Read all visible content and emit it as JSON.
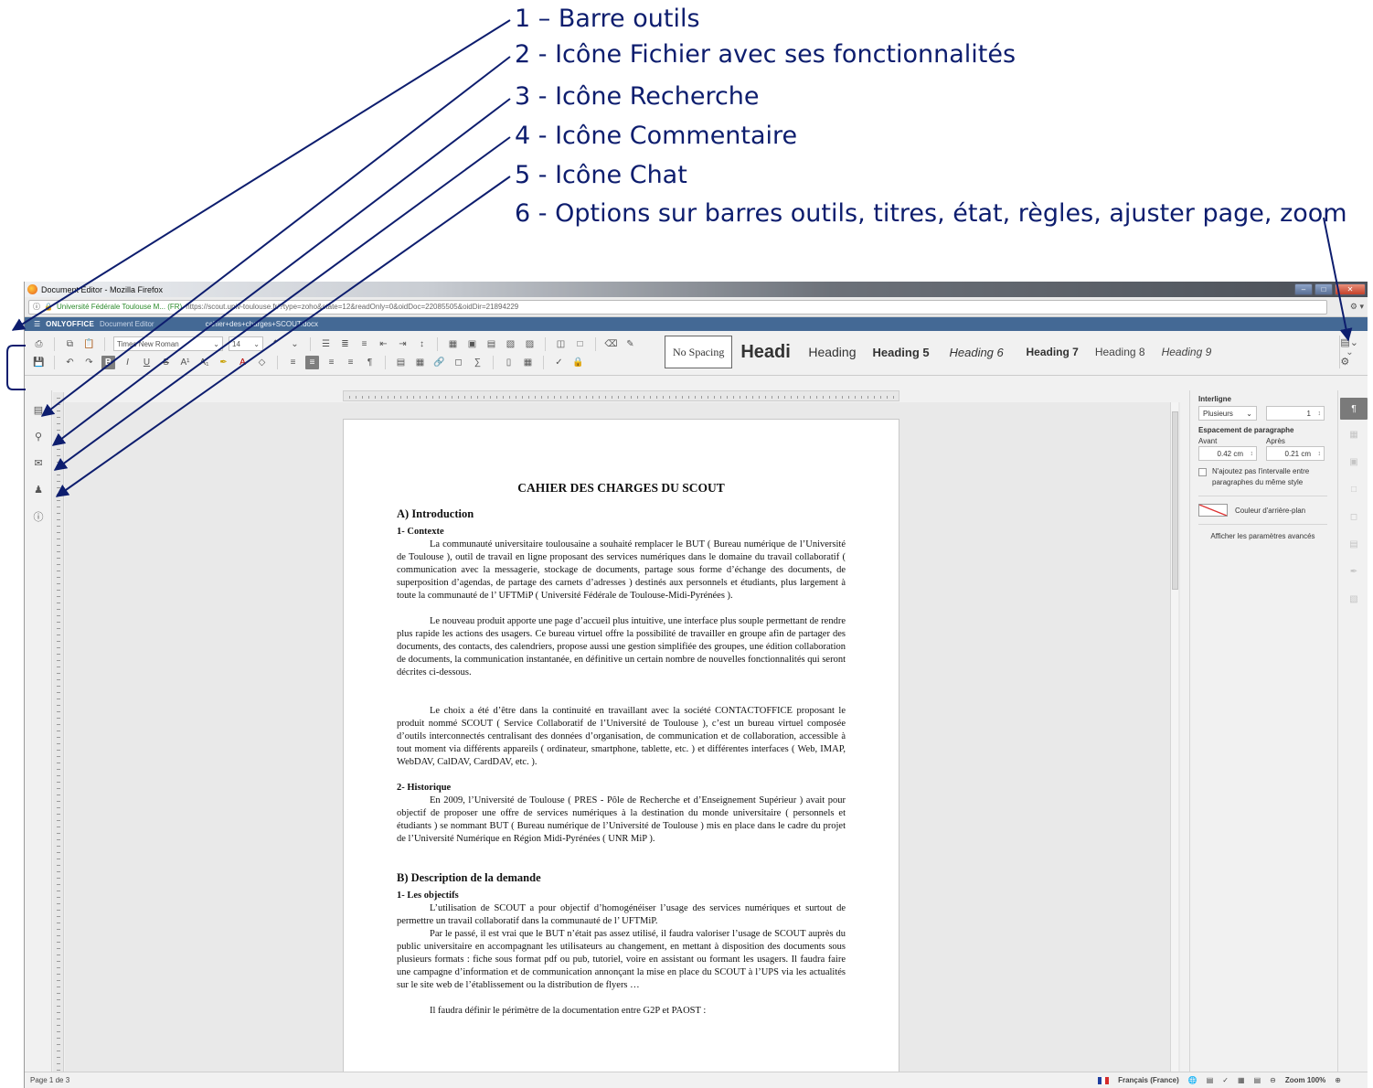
{
  "annotations": [
    "1 – Barre outils",
    "2 - Icône Fichier avec ses fonctionnalités",
    "3 - Icône Recherche",
    "4 - Icône Commentaire",
    "5 - Icône Chat",
    "6 - Options sur barres outils, titres, état, règles, ajuster page, zoom"
  ],
  "browser": {
    "title": "Document Editor - Mozilla Firefox",
    "site_identity": "Université Fédérale Toulouse M... (FR)",
    "url": "https://scout.univ-toulouse.fr/?type=zoho&state=12&readOnly=0&oidDoc=22085505&oidDir=21894229"
  },
  "app": {
    "brand": "ONLYOFFICE",
    "subtitle": "Document Editor",
    "doc_name": "cahier+des+charges+SCOUT.docx"
  },
  "toolbar": {
    "font_name": "Times New Roman",
    "font_size": "14",
    "styles": [
      "No Spacing",
      "Headi",
      "Heading",
      "Heading 5",
      "Heading 6",
      "Heading 7",
      "Heading 8",
      "Heading 9"
    ]
  },
  "document": {
    "title": "CAHIER DES CHARGES DU SCOUT",
    "section_a": "A) Introduction",
    "sub_1": "1- Contexte",
    "p1": "La communauté universitaire toulousaine a souhaité remplacer le BUT ( Bureau numérique de l’Université de Toulouse ), outil de travail en ligne proposant des services numériques dans le domaine du travail collaboratif ( communication avec la messagerie, stockage de documents, partage sous forme d’échange des documents, de superposition d’agendas, de partage des carnets d’adresses ) destinés aux personnels et étudiants, plus largement à toute la communauté de l’ UFTMiP ( Université Fédérale de Toulouse-Midi-Pyrénées ).",
    "p2": "Le nouveau produit apporte une page d’accueil plus intuitive, une interface plus souple permettant de rendre plus rapide les actions des usagers. Ce bureau virtuel offre la possibilité de travailler en groupe afin de partager des documents, des contacts, des calendriers, propose aussi une gestion simplifiée des groupes, une édition collaboration de documents, la communication instantanée, en définitive un certain nombre de nouvelles fonctionnalités qui seront décrites ci-dessous.",
    "p3": "Le choix a été d’être dans la continuité en travaillant avec la société CONTACTOFFICE proposant le produit nommé SCOUT ( Service Collaboratif de l’Université de Toulouse ), c’est un bureau virtuel composée d’outils interconnectés centralisant des données d’organisation, de communication et de collaboration, accessible à tout moment via différents appareils ( ordinateur, smartphone, tablette, etc. ) et différentes interfaces ( Web, IMAP, WebDAV, CalDAV, CardDAV, etc. ).",
    "sub_2": "2- Historique",
    "p4": "En 2009, l’Université de Toulouse ( PRES - Pôle de Recherche et d’Enseignement Supérieur ) avait pour objectif de proposer une offre de services numériques à la destination du monde universitaire ( personnels et étudiants ) se nommant BUT ( Bureau numérique de l’Université de Toulouse ) mis en place dans le cadre du projet de l’Université Numérique en Région Midi-Pyrénées ( UNR MiP ).",
    "section_b": "B) Description de la demande",
    "sub_3": "1- Les objectifs",
    "p5": "L’utilisation de SCOUT a pour objectif d’homogénéiser l’usage des services numériques et surtout de permettre un travail collaboratif dans la communauté de l’ UFTMiP.",
    "p6": "Par le passé, il est vrai que le BUT n’était pas assez utilisé, il faudra valoriser l’usage de SCOUT auprès du public universitaire en accompagnant les utilisateurs au changement, en mettant à disposition des documents sous plusieurs formats : fiche sous format pdf ou pub, tutoriel, voire en assistant ou formant les usagers. Il faudra faire une campagne d’information et de communication annonçant la mise en place du SCOUT à l’UPS via les actualités sur le site web de l’établissement ou la distribution de flyers …",
    "p7": "Il faudra définir le périmètre de la documentation entre G2P et PAOST :"
  },
  "right_panel": {
    "line_spacing_label": "Interligne",
    "line_spacing_mode": "Plusieurs",
    "line_spacing_value": "1",
    "para_spacing_label": "Espacement de paragraphe",
    "before_label": "Avant",
    "after_label": "Après",
    "before_value": "0.42 cm",
    "after_value": "0.21 cm",
    "no_interval_label": "N'ajoutez pas l'intervalle entre paragraphes du même style",
    "bg_color_label": "Couleur d'arrière-plan",
    "advanced_link": "Afficher les paramètres avancés"
  },
  "status": {
    "page": "Page 1 de 3",
    "language": "Français (France)",
    "zoom": "Zoom 100%"
  }
}
